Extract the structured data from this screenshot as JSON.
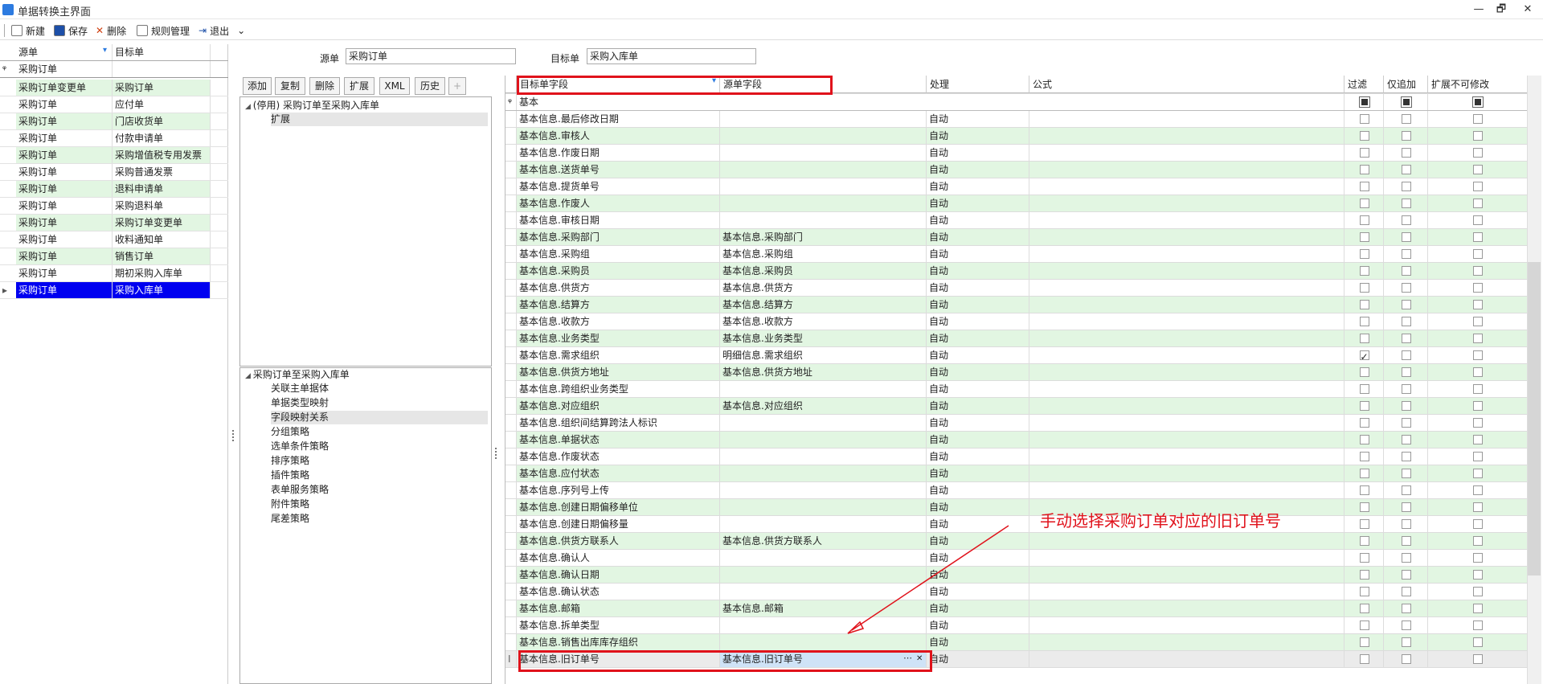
{
  "window": {
    "title": "单据转换主界面",
    "min": "—",
    "restore": "🗗",
    "close": "✕"
  },
  "toolbar": {
    "new": "新建",
    "save": "保存",
    "delete": "删除",
    "rules": "规则管理",
    "exit": "退出"
  },
  "left_grid": {
    "headers": [
      "源单",
      "目标单"
    ],
    "filter_row": "采购订单",
    "rows": [
      [
        "采购订单变更单",
        "采购订单"
      ],
      [
        "采购订单",
        "应付单"
      ],
      [
        "采购订单",
        "门店收货单"
      ],
      [
        "采购订单",
        "付款申请单"
      ],
      [
        "采购订单",
        "采购增值税专用发票"
      ],
      [
        "采购订单",
        "采购普通发票"
      ],
      [
        "采购订单",
        "退料申请单"
      ],
      [
        "采购订单",
        "采购退料单"
      ],
      [
        "采购订单",
        "采购订单变更单"
      ],
      [
        "采购订单",
        "收料通知单"
      ],
      [
        "采购订单",
        "销售订单"
      ],
      [
        "采购订单",
        "期初采购入库单"
      ],
      [
        "采购订单",
        "采购入库单"
      ]
    ]
  },
  "form": {
    "source_label": "源单",
    "source_value": "采购订单",
    "target_label": "目标单",
    "target_value": "采购入库单"
  },
  "mid_buttons": [
    "添加",
    "复制",
    "删除",
    "扩展",
    "XML",
    "历史",
    "+"
  ],
  "tree1": {
    "root": "(停用) 采购订单至采购入库单",
    "child": "扩展"
  },
  "tree2": {
    "root": "采购订单至采购入库单",
    "items": [
      "关联主单据体",
      "单据类型映射",
      "字段映射关系",
      "分组策略",
      "选单条件策略",
      "排序策略",
      "插件策略",
      "表单服务策略",
      "附件策略",
      "尾差策略"
    ]
  },
  "grid": {
    "headers": [
      "目标单字段",
      "源单字段",
      "处理",
      "公式",
      "过滤",
      "仅追加",
      "扩展不可修改"
    ],
    "group": "基本",
    "rows": [
      [
        "基本信息.最后修改日期",
        "",
        "自动",
        false
      ],
      [
        "基本信息.审核人",
        "",
        "自动",
        false
      ],
      [
        "基本信息.作废日期",
        "",
        "自动",
        false
      ],
      [
        "基本信息.送货单号",
        "",
        "自动",
        false
      ],
      [
        "基本信息.提货单号",
        "",
        "自动",
        false
      ],
      [
        "基本信息.作废人",
        "",
        "自动",
        false
      ],
      [
        "基本信息.审核日期",
        "",
        "自动",
        false
      ],
      [
        "基本信息.采购部门",
        "基本信息.采购部门",
        "自动",
        false
      ],
      [
        "基本信息.采购组",
        "基本信息.采购组",
        "自动",
        false
      ],
      [
        "基本信息.采购员",
        "基本信息.采购员",
        "自动",
        false
      ],
      [
        "基本信息.供货方",
        "基本信息.供货方",
        "自动",
        false
      ],
      [
        "基本信息.结算方",
        "基本信息.结算方",
        "自动",
        false
      ],
      [
        "基本信息.收款方",
        "基本信息.收款方",
        "自动",
        false
      ],
      [
        "基本信息.业务类型",
        "基本信息.业务类型",
        "自动",
        false
      ],
      [
        "基本信息.需求组织",
        "明细信息.需求组织",
        "自动",
        true
      ],
      [
        "基本信息.供货方地址",
        "基本信息.供货方地址",
        "自动",
        false
      ],
      [
        "基本信息.跨组织业务类型",
        "",
        "自动",
        false
      ],
      [
        "基本信息.对应组织",
        "基本信息.对应组织",
        "自动",
        false
      ],
      [
        "基本信息.组织间结算跨法人标识",
        "",
        "自动",
        false
      ],
      [
        "基本信息.单据状态",
        "",
        "自动",
        false
      ],
      [
        "基本信息.作废状态",
        "",
        "自动",
        false
      ],
      [
        "基本信息.应付状态",
        "",
        "自动",
        false
      ],
      [
        "基本信息.序列号上传",
        "",
        "自动",
        false
      ],
      [
        "基本信息.创建日期偏移单位",
        "",
        "自动",
        false
      ],
      [
        "基本信息.创建日期偏移量",
        "",
        "自动",
        false
      ],
      [
        "基本信息.供货方联系人",
        "基本信息.供货方联系人",
        "自动",
        false
      ],
      [
        "基本信息.确认人",
        "",
        "自动",
        false
      ],
      [
        "基本信息.确认日期",
        "",
        "自动",
        false
      ],
      [
        "基本信息.确认状态",
        "",
        "自动",
        false
      ],
      [
        "基本信息.邮箱",
        "基本信息.邮箱",
        "自动",
        false
      ],
      [
        "基本信息.拆单类型",
        "",
        "自动",
        false
      ],
      [
        "基本信息.销售出库库存组织",
        "",
        "自动",
        false
      ],
      [
        "基本信息.旧订单号",
        "基本信息.旧订单号",
        "自动",
        false
      ]
    ],
    "edit_buttons": "⋯"
  },
  "annotation": "手动选择采购订单对应的旧订单号"
}
